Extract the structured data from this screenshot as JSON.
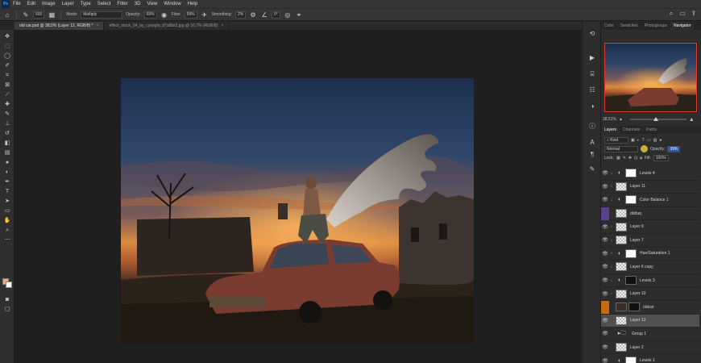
{
  "menu": {
    "logo": "Ps",
    "items": [
      "File",
      "Edit",
      "Image",
      "Layer",
      "Type",
      "Select",
      "Filter",
      "3D",
      "View",
      "Window",
      "Help"
    ]
  },
  "options": {
    "mode_label": "Mode:",
    "mode_value": "Multiply",
    "opacity_label": "Opacity:",
    "opacity_value": "69%",
    "flow_label": "Flow:",
    "flow_value": "59%",
    "smoothing_label": "Smoothing:",
    "smoothing_value": "2%",
    "angle_value": "0°",
    "brush_size": "500"
  },
  "tabs": [
    {
      "label": "old car.psd @ 38,5% (Layer 12, RGB/8) *",
      "active": true
    },
    {
      "label": "effect_stock_04_by_cyoogfa_d7a8lzt2.jpg @ 16,7% (RGB/8)",
      "active": false
    }
  ],
  "panel_top": {
    "tabs": [
      "Color",
      "Swatches",
      "Photogroups",
      "Navigator"
    ],
    "active_tab": "Navigator",
    "zoom_value": "38,51%"
  },
  "layers_panel": {
    "tabs": [
      "Layers",
      "Channels",
      "Paths"
    ],
    "active_tab": "Layers",
    "filter_label": "Kind",
    "blend_mode": "Normal",
    "opacity_label": "Opacity:",
    "opacity_value": "39%",
    "lock_label": "Lock:",
    "fill_label": "Fill:",
    "fill_value": "100%",
    "layers": [
      {
        "name": "Levels 4",
        "kind": "adjustment",
        "visible": true,
        "clipped": true
      },
      {
        "name": "Layer 11",
        "kind": "pixel",
        "visible": true,
        "clipped": true
      },
      {
        "name": "Color Balance 1",
        "kind": "adjustment",
        "visible": true,
        "clipped": true
      },
      {
        "name": "ddduq",
        "kind": "smart",
        "visible": false,
        "clipped": false,
        "badge": "#5c3f8f"
      },
      {
        "name": "Layer 9",
        "kind": "pixel",
        "visible": true,
        "clipped": true
      },
      {
        "name": "Layer 7",
        "kind": "pixel",
        "visible": true,
        "clipped": true
      },
      {
        "name": "Hue/Saturation 1",
        "kind": "adjustment",
        "visible": true,
        "clipped": true
      },
      {
        "name": "Layer 6 copy",
        "kind": "pixel",
        "visible": true,
        "clipped": true
      },
      {
        "name": "Levels 3",
        "kind": "adjustment",
        "visible": true,
        "clipped": true,
        "mask": "dark"
      },
      {
        "name": "Layer 10",
        "kind": "pixel",
        "visible": true,
        "clipped": true
      },
      {
        "name": "oldcar",
        "kind": "photo",
        "visible": false,
        "clipped": false,
        "badge": "#c86a13",
        "mask": "dark"
      },
      {
        "name": "Layer 12",
        "kind": "pixel",
        "visible": true,
        "clipped": false,
        "selected": true
      },
      {
        "name": "Group 1",
        "kind": "group",
        "visible": true,
        "clipped": false
      },
      {
        "name": "Layer 2",
        "kind": "pixel",
        "visible": true,
        "clipped": false
      },
      {
        "name": "Levels 1",
        "kind": "adjustment",
        "visible": true,
        "clipped": false
      }
    ]
  }
}
